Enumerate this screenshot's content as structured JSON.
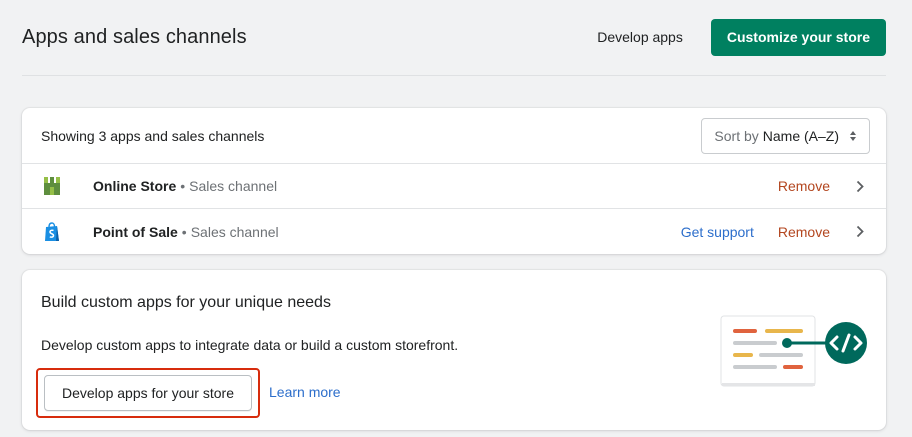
{
  "header": {
    "title": "Apps and sales channels",
    "develop_label": "Develop apps",
    "customize_label": "Customize your store"
  },
  "apps": {
    "count_text": "Showing 3 apps and sales channels",
    "sort": {
      "label": "Sort by",
      "value": "Name (A–Z)"
    },
    "items": [
      {
        "name": "Online Store",
        "separator": "•",
        "type": "Sales channel",
        "support": "",
        "remove": "Remove",
        "icon": "online-store-icon"
      },
      {
        "name": "Point of Sale",
        "separator": "•",
        "type": "Sales channel",
        "support": "Get support",
        "remove": "Remove",
        "icon": "shopify-bag-icon"
      }
    ]
  },
  "build": {
    "title": "Build custom apps for your unique needs",
    "description": "Develop custom apps to integrate data or build a custom storefront.",
    "button_label": "Develop apps for your store",
    "learn_more": "Learn more"
  },
  "colors": {
    "primary": "#008060",
    "remove": "#b3461f",
    "link": "#2c6ecb",
    "highlight": "#d72c0d"
  }
}
